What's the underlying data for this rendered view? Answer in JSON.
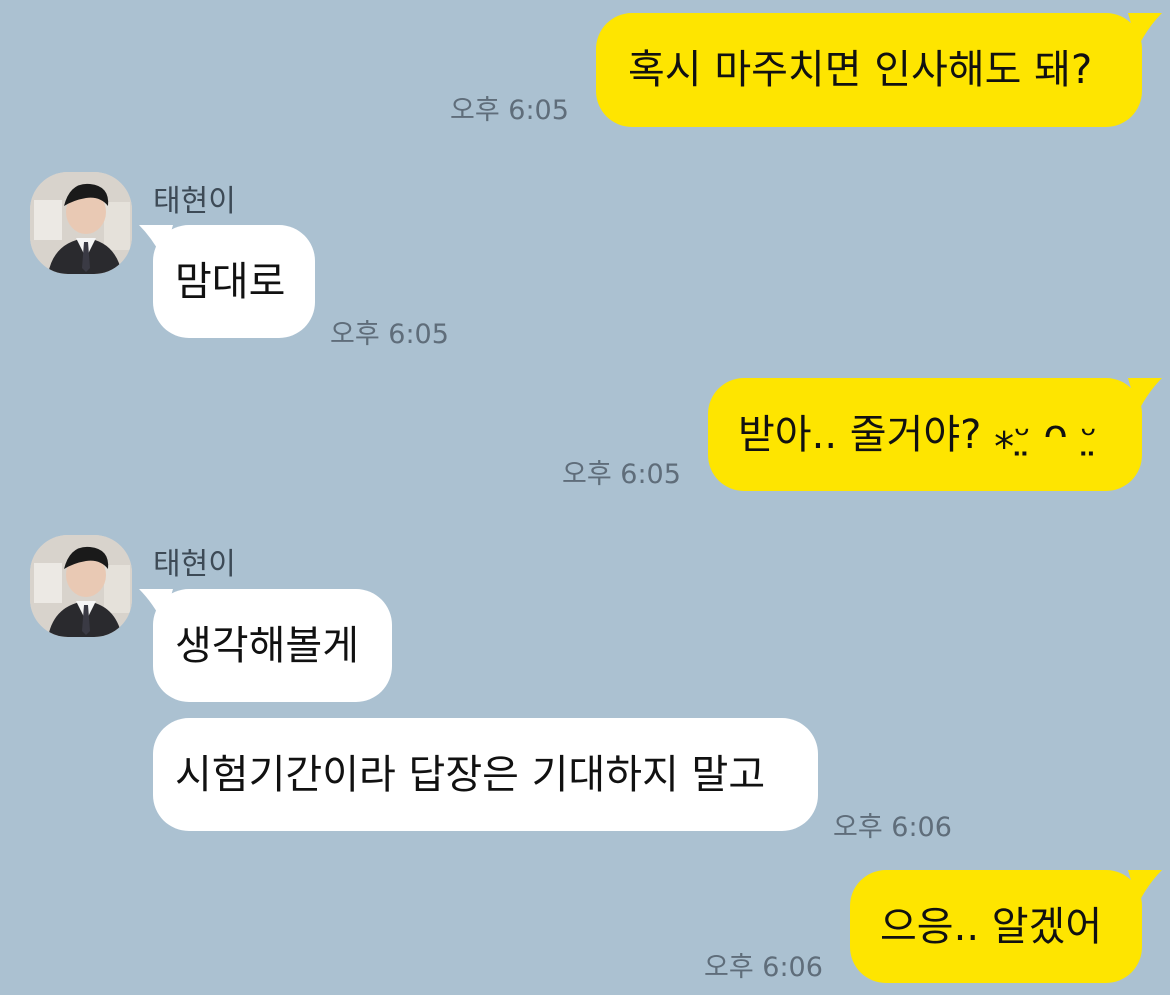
{
  "messages": [
    {
      "side": "out",
      "text": "혹시 마주치면 인사해도 돼?",
      "time": "오후 6:05"
    },
    {
      "side": "in",
      "sender": "태현이",
      "text": "맘대로",
      "time": "오후 6:05"
    },
    {
      "side": "out",
      "text": "받아.. 줄거야? ⁎ᵕ̤ ᴖ ᵕ̤",
      "time": "오후 6:05"
    },
    {
      "side": "in",
      "sender": "태현이",
      "text": "생각해볼게",
      "time": ""
    },
    {
      "side": "in",
      "text": "시험기간이라 답장은 기대하지 말고",
      "time": "오후 6:06"
    },
    {
      "side": "out",
      "text": "으응.. 알겠어",
      "time": "오후 6:06"
    }
  ],
  "colors": {
    "background": "#abc1d1",
    "outgoing_bubble": "#fee500",
    "incoming_bubble": "#ffffff",
    "timestamp": "#5f6d7a",
    "sender_name": "#3d4a56"
  },
  "icons": {
    "avatar": "profile-photo-avatar"
  }
}
